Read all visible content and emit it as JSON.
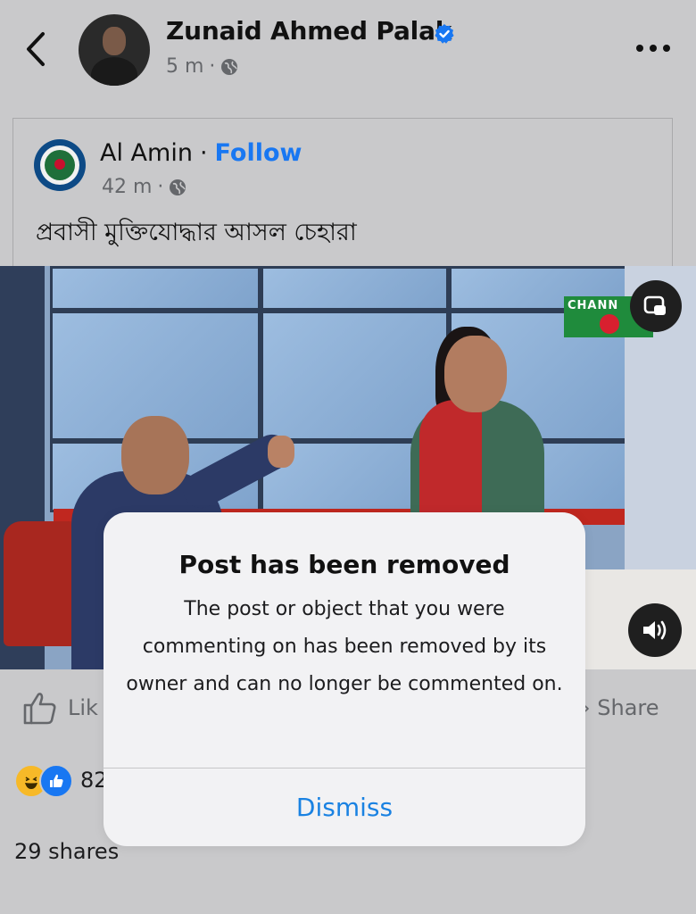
{
  "header": {
    "back_icon": "chevron-left-icon",
    "author_name": "Zunaid Ahmed Palak",
    "time": "5 m",
    "separator": "·",
    "audience_icon": "globe-icon",
    "verified_icon": "verified-badge-icon",
    "more_icon": "more-horizontal-icon"
  },
  "shared_post": {
    "author_name": "Al Amin",
    "separator": "·",
    "follow_label": "Follow",
    "time": "42 m",
    "caption": "প্রবাসী মুক্তিযোদ্ধার আসল চেহারা",
    "video": {
      "channel_logo_text": "CHANN",
      "pip_icon": "picture-in-picture-icon",
      "sound_icon": "speaker-icon"
    }
  },
  "actions": {
    "like_label": "Lik",
    "share_label": "Share",
    "share_arrow": "›"
  },
  "reactions": {
    "count": "82",
    "icons": [
      "haha-reaction-icon",
      "like-reaction-icon"
    ]
  },
  "shares_text": "29 shares",
  "dialog": {
    "title": "Post has been removed",
    "message": "The post or object that you were commenting on has been removed by its owner and can no longer be commented on.",
    "dismiss_label": "Dismiss"
  },
  "colors": {
    "background": "#c9c9cb",
    "link_blue": "#1877f2",
    "dismiss_blue": "#1a82e2",
    "dialog_bg": "#f2f2f4"
  }
}
